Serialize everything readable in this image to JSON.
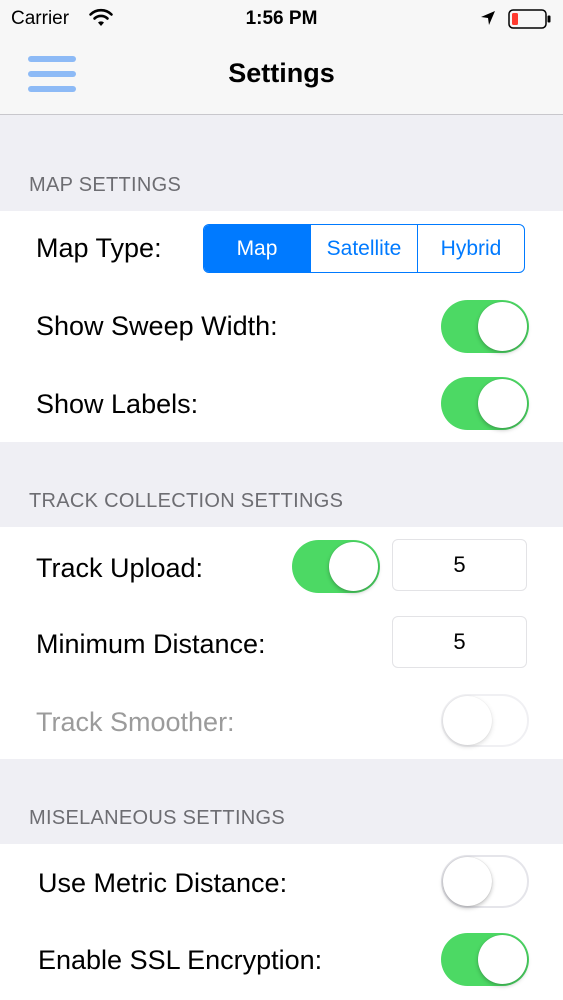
{
  "status_bar": {
    "carrier": "Carrier",
    "time": "1:56 PM",
    "icons": [
      "wifi-icon",
      "location-icon",
      "battery-icon"
    ],
    "battery_color": "#ff3b30"
  },
  "nav": {
    "title": "Settings",
    "menu_icon": "hamburger-menu-icon",
    "menu_color": "#8dbaf6"
  },
  "map_settings": {
    "header": "MAP SETTINGS",
    "map_type_label": "Map Type:",
    "map_type_options": [
      "Map",
      "Satellite",
      "Hybrid"
    ],
    "map_type_selected": "Map",
    "sweep_width_label": "Show Sweep Width:",
    "sweep_width_on": true,
    "labels_label": "Show Labels:",
    "labels_on": true
  },
  "track_settings": {
    "header": "TRACK COLLECTION SETTINGS",
    "upload_label": "Track Upload:",
    "upload_on": true,
    "upload_value": "5",
    "min_distance_label": "Minimum Distance:",
    "min_distance_value": "5",
    "smoother_label": "Track Smoother:",
    "smoother_on": false,
    "smoother_enabled": false
  },
  "misc_settings": {
    "header": "MISELANEOUS SETTINGS",
    "metric_label": "Use Metric Distance:",
    "metric_on": false,
    "ssl_label": "Enable SSL Encryption:",
    "ssl_on": true
  },
  "colors": {
    "accent": "#007aff",
    "toggle_on": "#4cd964",
    "background": "#efeff4"
  }
}
